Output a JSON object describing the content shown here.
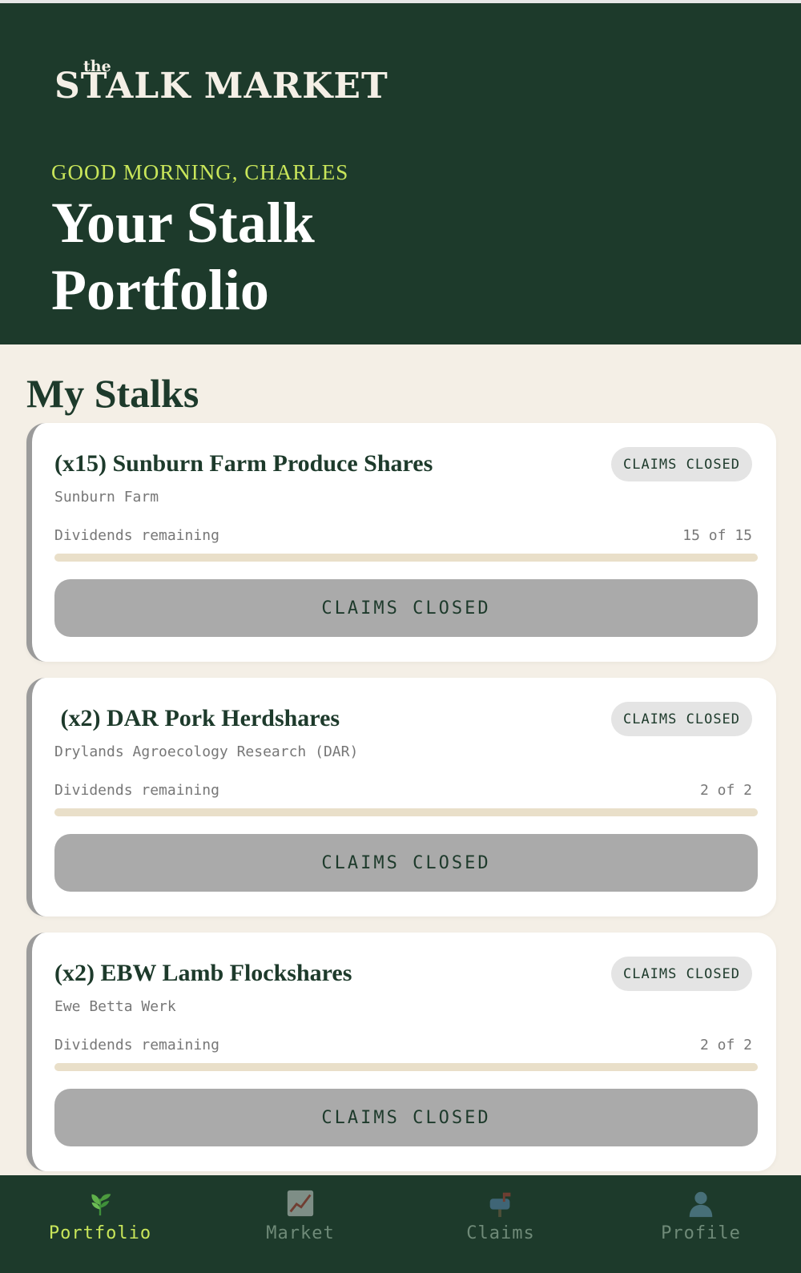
{
  "header": {
    "logo_the": "the",
    "logo_main": "STALK MARKET",
    "greeting": "GOOD MORNING, CHARLES",
    "title": "Your Stalk Portfolio"
  },
  "section_title": "My Stalks",
  "cards": [
    {
      "name": "(x15) Sunburn Farm Produce Shares",
      "badge": "CLAIMS CLOSED",
      "farm": "Sunburn Farm",
      "dividends_label": "Dividends remaining",
      "dividends_count": "15 of 15",
      "dividends_remaining_fraction": 1.0,
      "button_label": "CLAIMS CLOSED"
    },
    {
      "name": " (x2) DAR Pork Herdshares",
      "badge": "CLAIMS CLOSED",
      "farm": "Drylands Agroecology Research (DAR)",
      "dividends_label": "Dividends remaining",
      "dividends_count": "2 of 2",
      "dividends_remaining_fraction": 1.0,
      "button_label": "CLAIMS CLOSED"
    },
    {
      "name": "(x2) EBW Lamb Flockshares",
      "badge": "CLAIMS CLOSED",
      "farm": "Ewe Betta Werk",
      "dividends_label": "Dividends remaining",
      "dividends_count": "2 of 2",
      "dividends_remaining_fraction": 1.0,
      "button_label": "CLAIMS CLOSED"
    }
  ],
  "nav": {
    "items": [
      {
        "label": "Portfolio",
        "icon": "seedling-icon",
        "active": true
      },
      {
        "label": "Market",
        "icon": "chart-increasing-icon",
        "active": false
      },
      {
        "label": "Claims",
        "icon": "mailbox-icon",
        "active": false
      },
      {
        "label": "Profile",
        "icon": "user-silhouette-icon",
        "active": false
      }
    ]
  },
  "colors": {
    "header_bg": "#1d3a2b",
    "page_bg": "#f4efe6",
    "accent": "#c9e65a",
    "button_disabled": "#aaaaaa",
    "progress_track": "#e9dfc9"
  }
}
